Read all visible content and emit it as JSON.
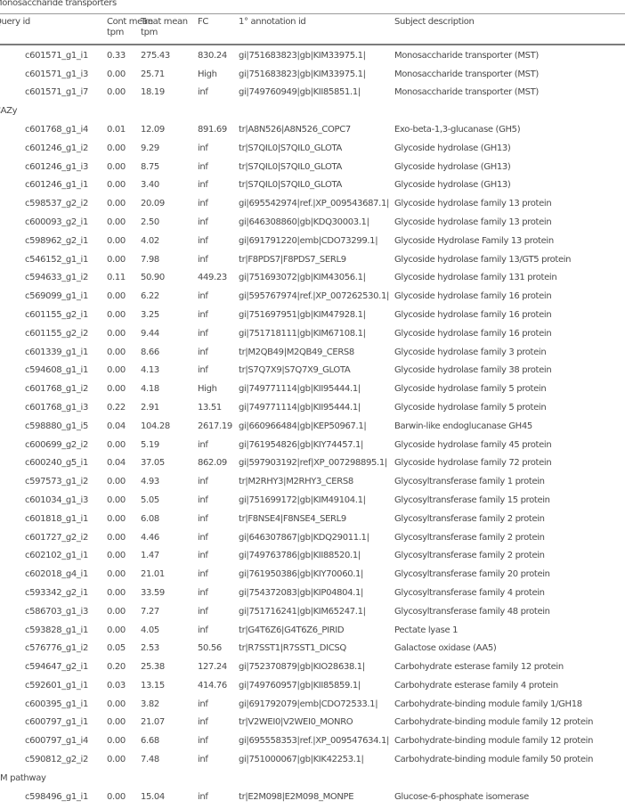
{
  "table": {
    "columns": {
      "query_id": "Query id",
      "cont_mean": "Cont mean\ntpm",
      "cont_mean_l1": "Cont mean",
      "cont_mean_l2": "tpm",
      "treat_mean_l1": "Treat mean",
      "treat_mean_l2": "tpm",
      "fc": "FC",
      "annotation": "1° annotation id",
      "description": "Subject description"
    },
    "groups": [
      {
        "label": "Monosaccharide transporters",
        "rows": [
          {
            "query": "c601571_g1_i1",
            "cont": "0.33",
            "treat": "275.43",
            "fc": "830.24",
            "ann": "gi|751683823|gb|KIM33975.1|",
            "desc": "Monosaccharide transporter (MST)"
          },
          {
            "query": "c601571_g1_i3",
            "cont": "0.00",
            "treat": "25.71",
            "fc": "High",
            "ann": "gi|751683823|gb|KIM33975.1|",
            "desc": "Monosaccharide transporter (MST)"
          },
          {
            "query": "c601571_g1_i7",
            "cont": "0.00",
            "treat": "18.19",
            "fc": "inf",
            "ann": "gi|749760949|gb|KII85851.1|",
            "desc": "Monosaccharide transporter (MST)"
          }
        ]
      },
      {
        "label": "CAZy",
        "rows": [
          {
            "query": "c601768_g1_i4",
            "cont": "0.01",
            "treat": "12.09",
            "fc": "891.69",
            "ann": "tr|A8N526|A8N526_COPC7",
            "desc": "Exo-beta-1,3-glucanase (GH5)"
          },
          {
            "query": "c601246_g1_i2",
            "cont": "0.00",
            "treat": "9.29",
            "fc": "inf",
            "ann": "tr|S7QIL0|S7QIL0_GLOTA",
            "desc": "Glycoside hydrolase (GH13)"
          },
          {
            "query": "c601246_g1_i3",
            "cont": "0.00",
            "treat": "8.75",
            "fc": "inf",
            "ann": "tr|S7QIL0|S7QIL0_GLOTA",
            "desc": "Glycoside hydrolase (GH13)"
          },
          {
            "query": "c601246_g1_i1",
            "cont": "0.00",
            "treat": "3.40",
            "fc": "inf",
            "ann": "tr|S7QIL0|S7QIL0_GLOTA",
            "desc": "Glycoside hydrolase (GH13)"
          },
          {
            "query": "c598537_g2_i2",
            "cont": "0.00",
            "treat": "20.09",
            "fc": "inf",
            "ann": "gi|695542974|ref.|XP_009543687.1|",
            "desc": "Glycoside hydrolase family 13 protein"
          },
          {
            "query": "c600093_g2_i1",
            "cont": "0.00",
            "treat": "2.50",
            "fc": "inf",
            "ann": "gi|646308860|gb|KDQ30003.1|",
            "desc": "Glycoside hydrolase family 13 protein"
          },
          {
            "query": "c598962_g2_i1",
            "cont": "0.00",
            "treat": "4.02",
            "fc": "inf",
            "ann": "gi|691791220|emb|CDO73299.1|",
            "desc": "Glycoside Hydrolase Family 13 protein"
          },
          {
            "query": "c546152_g1_i1",
            "cont": "0.00",
            "treat": "7.98",
            "fc": "inf",
            "ann": "tr|F8PDS7|F8PDS7_SERL9",
            "desc": "Glycoside hydrolase family 13/GT5 protein"
          },
          {
            "query": "c594633_g1_i2",
            "cont": "0.11",
            "treat": "50.90",
            "fc": "449.23",
            "ann": "gi|751693072|gb|KIM43056.1|",
            "desc": "Glycoside hydrolase family 131 protein"
          },
          {
            "query": "c569099_g1_i1",
            "cont": "0.00",
            "treat": "6.22",
            "fc": "inf",
            "ann": "gi|595767974|ref.|XP_007262530.1|",
            "desc": "Glycoside hydrolase family 16 protein"
          },
          {
            "query": "c601155_g2_i1",
            "cont": "0.00",
            "treat": "3.25",
            "fc": "inf",
            "ann": "gi|751697951|gb|KIM47928.1|",
            "desc": "Glycoside hydrolase family 16 protein"
          },
          {
            "query": "c601155_g2_i2",
            "cont": "0.00",
            "treat": "9.44",
            "fc": "inf",
            "ann": "gi|751718111|gb|KIM67108.1|",
            "desc": "Glycoside hydrolase family 16 protein"
          },
          {
            "query": "c601339_g1_i1",
            "cont": "0.00",
            "treat": "8.66",
            "fc": "inf",
            "ann": "tr|M2QB49|M2QB49_CERS8",
            "desc": "Glycoside hydrolase family 3 protein"
          },
          {
            "query": "c594608_g1_i1",
            "cont": "0.00",
            "treat": "4.13",
            "fc": "inf",
            "ann": "tr|S7Q7X9|S7Q7X9_GLOTA",
            "desc": "Glycoside hydrolase family 38 protein"
          },
          {
            "query": "c601768_g1_i2",
            "cont": "0.00",
            "treat": "4.18",
            "fc": "High",
            "ann": "gi|749771114|gb|KII95444.1|",
            "desc": "Glycoside hydrolase family 5 protein"
          },
          {
            "query": "c601768_g1_i3",
            "cont": "0.22",
            "treat": "2.91",
            "fc": "13.51",
            "ann": "gi|749771114|gb|KII95444.1|",
            "desc": "Glycoside hydrolase family 5 protein"
          },
          {
            "query": "c598880_g1_i5",
            "cont": "0.04",
            "treat": "104.28",
            "fc": "2617.19",
            "ann": "gi|660966484|gb|KEP50967.1|",
            "desc": "Barwin-like endoglucanase GH45"
          },
          {
            "query": "c600699_g2_i2",
            "cont": "0.00",
            "treat": "5.19",
            "fc": "inf",
            "ann": "gi|761954826|gb|KIY74457.1|",
            "desc": "Glycoside hydrolase family 45 protein"
          },
          {
            "query": "c600240_g5_i1",
            "cont": "0.04",
            "treat": "37.05",
            "fc": "862.09",
            "ann": "gi|597903192|ref|XP_007298895.1|",
            "desc": "Glycoside hydrolase family 72 protein"
          },
          {
            "query": "c597573_g1_i2",
            "cont": "0.00",
            "treat": "4.93",
            "fc": "inf",
            "ann": "tr|M2RHY3|M2RHY3_CERS8",
            "desc": "Glycosyltransferase family 1 protein"
          },
          {
            "query": "c601034_g1_i3",
            "cont": "0.00",
            "treat": "5.05",
            "fc": "inf",
            "ann": "gi|751699172|gb|KIM49104.1|",
            "desc": "Glycosyltransferase family 15 protein"
          },
          {
            "query": "c601818_g1_i1",
            "cont": "0.00",
            "treat": "6.08",
            "fc": "inf",
            "ann": "tr|F8NSE4|F8NSE4_SERL9",
            "desc": "Glycosyltransferase family 2 protein"
          },
          {
            "query": "c601727_g2_i2",
            "cont": "0.00",
            "treat": "4.46",
            "fc": "inf",
            "ann": "gi|646307867|gb|KDQ29011.1|",
            "desc": "Glycosyltransferase family 2 protein"
          },
          {
            "query": "c602102_g1_i1",
            "cont": "0.00",
            "treat": "1.47",
            "fc": "inf",
            "ann": "gi|749763786|gb|KII88520.1|",
            "desc": "Glycosyltransferase family 2 protein"
          },
          {
            "query": "c602018_g4_i1",
            "cont": "0.00",
            "treat": "21.01",
            "fc": "inf",
            "ann": "gi|761950386|gb|KIY70060.1|",
            "desc": "Glycosyltransferase family 20 protein"
          },
          {
            "query": "c593342_g2_i1",
            "cont": "0.00",
            "treat": "33.59",
            "fc": "inf",
            "ann": "gi|754372083|gb|KIP04804.1|",
            "desc": "Glycosyltransferase family 4 protein"
          },
          {
            "query": "c586703_g1_i3",
            "cont": "0.00",
            "treat": "7.27",
            "fc": "inf",
            "ann": "gi|751716241|gb|KIM65247.1|",
            "desc": "Glycosyltransferase family 48 protein"
          },
          {
            "query": "c593828_g1_i1",
            "cont": "0.00",
            "treat": "4.05",
            "fc": "inf",
            "ann": "tr|G4T6Z6|G4T6Z6_PIRID",
            "desc": "Pectate lyase 1"
          },
          {
            "query": "c576776_g1_i2",
            "cont": "0.05",
            "treat": "2.53",
            "fc": "50.56",
            "ann": "tr|R7SST1|R7SST1_DICSQ",
            "desc": "Galactose oxidase (AA5)"
          },
          {
            "query": "c594647_g2_i1",
            "cont": "0.20",
            "treat": "25.38",
            "fc": "127.24",
            "ann": "gi|752370879|gb|KIO28638.1|",
            "desc": "Carbohydrate esterase family 12 protein"
          },
          {
            "query": "c592601_g1_i1",
            "cont": "0.03",
            "treat": "13.15",
            "fc": "414.76",
            "ann": "gi|749760957|gb|KII85859.1|",
            "desc": "Carbohydrate esterase family 4 protein"
          },
          {
            "query": "c600395_g1_i1",
            "cont": "0.00",
            "treat": "3.82",
            "fc": "inf",
            "ann": "gi|691792079|emb|CDO72533.1|",
            "desc": "Carbohydrate-binding module family 1/GH18"
          },
          {
            "query": "c600797_g1_i1",
            "cont": "0.00",
            "treat": "21.07",
            "fc": "inf",
            "ann": "tr|V2WEI0|V2WEI0_MONRO",
            "desc": "Carbohydrate-binding module family 12 protein"
          },
          {
            "query": "c600797_g1_i4",
            "cont": "0.00",
            "treat": "6.68",
            "fc": "inf",
            "ann": "gi|695558353|ref.|XP_009547634.1|",
            "desc": "Carbohydrate-binding module family 12 protein"
          },
          {
            "query": "c590812_g2_i2",
            "cont": "0.00",
            "treat": "7.48",
            "fc": "inf",
            "ann": "gi|751000067|gb|KIK42253.1|",
            "desc": "Carbohydrate-binding module family 50 protein"
          }
        ]
      },
      {
        "label": "EM pathway",
        "rows": [
          {
            "query": "c598496_g1_i1",
            "cont": "0.00",
            "treat": "15.04",
            "fc": "inf",
            "ann": "tr|E2M098|E2M098_MONPE",
            "desc": "Glucose-6-phosphate isomerase"
          }
        ]
      }
    ]
  }
}
